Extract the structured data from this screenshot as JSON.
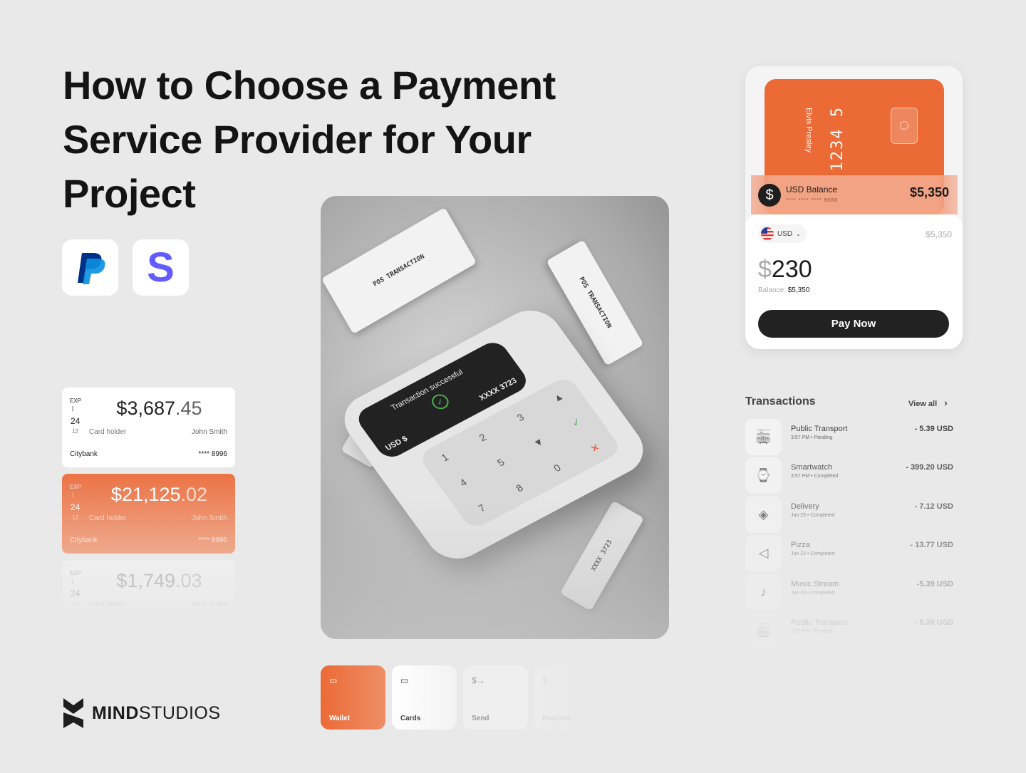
{
  "headline": "How to Choose a Payment Service Provider for Your Project",
  "logos": [
    {
      "name": "PayPal",
      "glyph": "P",
      "color": "#003087"
    },
    {
      "name": "Stripe",
      "glyph": "S",
      "color": "#635bff"
    }
  ],
  "cards": [
    {
      "exp": "EXP",
      "sep": "|",
      "year": "24",
      "month": "12",
      "amount_main": "$3,687",
      "amount_cents": ".45",
      "holder_label": "Card holder",
      "holder": "John Smith",
      "bank": "Citybank",
      "number": "**** 8996"
    },
    {
      "exp": "EXP",
      "sep": "|",
      "year": "24",
      "month": "12",
      "amount_main": "$21,125",
      "amount_cents": ".02",
      "holder_label": "Card holder",
      "holder": "John Smith",
      "bank": "Citybank",
      "number": "**** 8996"
    },
    {
      "exp": "EXP",
      "sep": "|",
      "year": "24",
      "month": "12",
      "amount_main": "$1,749",
      "amount_cents": ".03",
      "holder_label": "Card holder",
      "holder": "John Smith"
    }
  ],
  "photo": {
    "screen_text": "Transaction successful",
    "card_mask": "XXXX 3723",
    "currency": "USD $",
    "receipt_text": "POS TRANSACTION",
    "keys": [
      "1",
      "2",
      "3",
      "▲",
      "4",
      "5",
      "▼",
      "✓",
      "7",
      "8",
      "0",
      "✕"
    ]
  },
  "wallet": {
    "card_holder": "Elvis Presley",
    "card_number": "1234 5",
    "balance_label": "USD Balance",
    "balance_mask": "**** **** **** 9080",
    "balance": "$5,350",
    "currency": "USD",
    "currency_balance": "$5,350",
    "amount_symbol": "$",
    "amount": "230",
    "balance_caption": "Balance:",
    "balance_value": "$5,350",
    "pay_label": "Pay Now"
  },
  "transactions": {
    "title": "Transactions",
    "view_all": "View all",
    "items": [
      {
        "icon": "bus-icon",
        "name": "Public Transport",
        "sub": "3:57 PM  •  Pending",
        "amount": "- 5.39 USD"
      },
      {
        "icon": "watch-icon",
        "name": "Smartwatch",
        "sub": "3:57 PM  •  Completed",
        "amount": "- 399.20 USD"
      },
      {
        "icon": "box-icon",
        "name": "Delivery",
        "sub": "Jun 23  •  Completed",
        "amount": "- 7.12 USD"
      },
      {
        "icon": "pizza-icon",
        "name": "Pizza",
        "sub": "Jun 23  •  Completed",
        "amount": "- 13.77 USD"
      },
      {
        "icon": "music-icon",
        "name": "Music Stream",
        "sub": "Jun 20  •  Completed",
        "amount": "-5.39 USD"
      },
      {
        "icon": "bus-icon",
        "name": "Public Transport",
        "sub": "3:57 PM  •  Pending",
        "amount": "- 5.39 USD"
      }
    ]
  },
  "tabs": [
    {
      "label": "Wallet",
      "icon": "wallet-icon",
      "active": true
    },
    {
      "label": "Cards",
      "icon": "card-icon"
    },
    {
      "label": "Send",
      "icon": "send-icon"
    },
    {
      "label": "Request",
      "icon": "request-icon"
    }
  ],
  "brand": {
    "bold": "MIND",
    "light": "STUDIOS"
  },
  "colors": {
    "accent": "#ec6a36",
    "dark": "#222222",
    "background": "#e9e9e9"
  }
}
